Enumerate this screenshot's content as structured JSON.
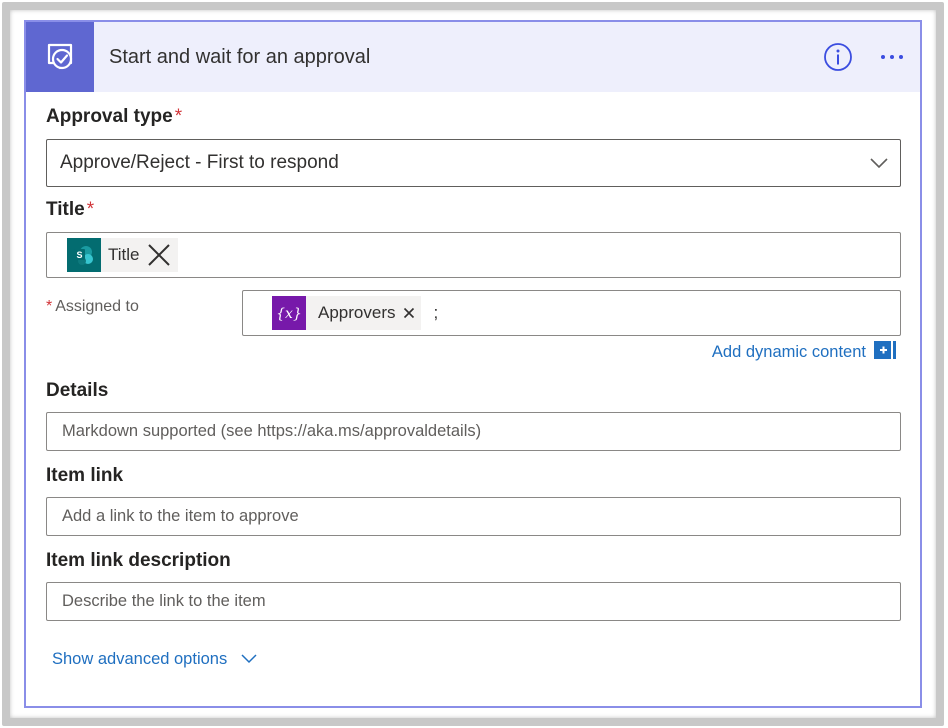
{
  "header": {
    "title": "Start and wait for an approval",
    "icons": [
      "approval-icon",
      "info-icon",
      "more-icon"
    ]
  },
  "approval_type": {
    "label": "Approval type",
    "required_marker": "*",
    "value": "Approve/Reject - First to respond"
  },
  "title_field": {
    "label": "Title",
    "required_marker": "*",
    "token": "Title",
    "token_icon": "sharepoint-icon"
  },
  "assigned_to": {
    "required_marker": "*",
    "label": "Assigned to",
    "token": "Approvers",
    "token_icon": "variable-icon",
    "separator": ";"
  },
  "dynamic_content": {
    "label": "Add dynamic content"
  },
  "details": {
    "label": "Details",
    "placeholder": "Markdown supported (see https://aka.ms/approvaldetails)"
  },
  "item_link": {
    "label": "Item link",
    "placeholder": "Add a link to the item to approve"
  },
  "item_link_description": {
    "label": "Item link description",
    "placeholder": "Describe the link to the item"
  },
  "advanced": {
    "label": "Show advanced options"
  },
  "colors": {
    "header_bg": "#eeeffc",
    "connector_icon_bg": "#5f67d1",
    "accent_blue": "#1f6fc0",
    "variable_purple": "#7719aa",
    "sharepoint_teal": "#036c70",
    "required_red": "#d13438"
  }
}
